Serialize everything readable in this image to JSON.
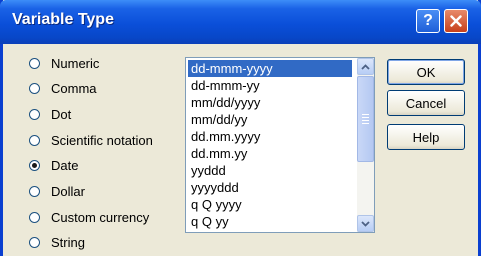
{
  "window": {
    "title": "Variable Type",
    "help_glyph": "?",
    "icons": {
      "help": "question-mark-icon",
      "close": "close-icon"
    }
  },
  "options": {
    "selected": "Date",
    "items": [
      {
        "label": "Numeric"
      },
      {
        "label": "Comma"
      },
      {
        "label": "Dot"
      },
      {
        "label": "Scientific notation"
      },
      {
        "label": "Date"
      },
      {
        "label": "Dollar"
      },
      {
        "label": "Custom currency"
      },
      {
        "label": "String"
      }
    ]
  },
  "format_list": {
    "selected": "dd-mmm-yyyy",
    "items": [
      "dd-mmm-yyyy",
      "dd-mmm-yy",
      "mm/dd/yyyy",
      "mm/dd/yy",
      "dd.mm.yyyy",
      "dd.mm.yy",
      "yyddd",
      "yyyyddd",
      "q Q yyyy",
      "q Q yy"
    ],
    "scrollbar": {
      "up_icon": "chevron-up-icon",
      "down_icon": "chevron-down-icon"
    }
  },
  "buttons": {
    "ok": "OK",
    "cancel": "Cancel",
    "help": "Help"
  },
  "colors": {
    "title_bar": "#0a4fd9",
    "dialog_bg": "#ece9d8",
    "selection": "#316ac5",
    "close_button": "#c8401c"
  }
}
